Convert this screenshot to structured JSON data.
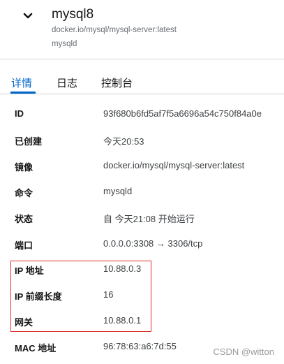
{
  "header": {
    "title": "mysql8",
    "image": "docker.io/mysql/mysql-server:latest",
    "command": "mysqld"
  },
  "tabs": [
    {
      "label": "详情",
      "active": true
    },
    {
      "label": "日志",
      "active": false
    },
    {
      "label": "控制台",
      "active": false
    }
  ],
  "details": [
    {
      "label": "ID",
      "value": "93f680b6fd5af7f5a6696a54c750f84a0e"
    },
    {
      "label": "已创建",
      "value": "今天20:53"
    },
    {
      "label": "镜像",
      "value": "docker.io/mysql/mysql-server:latest"
    },
    {
      "label": "命令",
      "value": "mysqld"
    },
    {
      "label": "状态",
      "value": "自 今天21:08 开始运行"
    },
    {
      "label": "端口",
      "value": "0.0.0.0:3308 → 3306/tcp"
    },
    {
      "label": "IP 地址",
      "value": "10.88.0.3"
    },
    {
      "label": "IP 前缀长度",
      "value": "16"
    },
    {
      "label": "网关",
      "value": "10.88.0.1"
    },
    {
      "label": "MAC 地址",
      "value": "96:78:63:a6:7d:55"
    }
  ],
  "colors": {
    "accent": "#0066cc",
    "highlight_border": "#e0302a"
  },
  "watermark": "CSDN @witton"
}
